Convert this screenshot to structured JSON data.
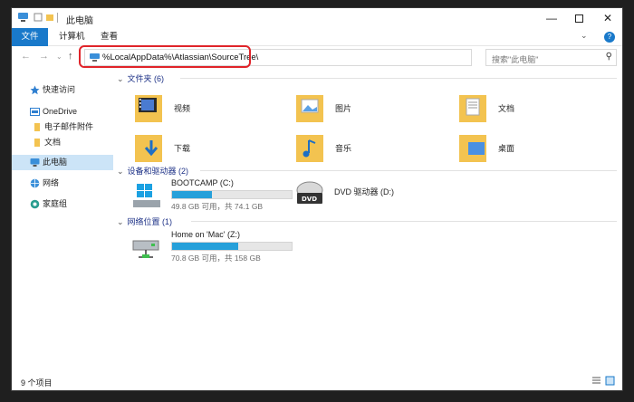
{
  "window": {
    "title": "此电脑"
  },
  "ribbon": {
    "tabs": [
      "文件",
      "计算机",
      "查看"
    ]
  },
  "address": {
    "path": "%LocalAppData%\\Atlassian\\SourceTree\\"
  },
  "search": {
    "placeholder": "搜索\"此电脑\""
  },
  "sidebar": {
    "items": [
      {
        "label": "快速访问",
        "icon": "star-icon"
      },
      {
        "label": "OneDrive",
        "icon": "cloud-icon"
      },
      {
        "label": "电子邮件附件",
        "icon": "folder-icon"
      },
      {
        "label": "文档",
        "icon": "folder-icon"
      },
      {
        "label": "此电脑",
        "icon": "computer-icon"
      },
      {
        "label": "网络",
        "icon": "network-icon"
      },
      {
        "label": "家庭组",
        "icon": "homegroup-icon"
      }
    ]
  },
  "folders": {
    "header": "文件夹 (6)",
    "items": [
      {
        "label": "视频",
        "icon": "videos-folder-icon"
      },
      {
        "label": "图片",
        "icon": "pictures-folder-icon"
      },
      {
        "label": "文档",
        "icon": "documents-folder-icon"
      },
      {
        "label": "下载",
        "icon": "downloads-folder-icon"
      },
      {
        "label": "音乐",
        "icon": "music-folder-icon"
      },
      {
        "label": "桌面",
        "icon": "desktop-folder-icon"
      }
    ]
  },
  "devices": {
    "header": "设备和驱动器 (2)",
    "items": [
      {
        "name": "BOOTCAMP (C:)",
        "free": "49.8 GB 可用，共 74.1 GB",
        "used_fraction": 0.33
      },
      {
        "name": "DVD 驱动器 (D:)"
      }
    ]
  },
  "network": {
    "header": "网络位置 (1)",
    "items": [
      {
        "name": "Home on 'Mac' (Z:)",
        "free": "70.8 GB 可用，共 158 GB",
        "used_fraction": 0.55
      }
    ]
  },
  "status": {
    "count": "9 个项目"
  },
  "colors": {
    "accent": "#1979ca",
    "selection": "#cce4f7",
    "drive_bar": "#26a0da",
    "highlight": "#e0242a",
    "folder": "#f3c350"
  }
}
